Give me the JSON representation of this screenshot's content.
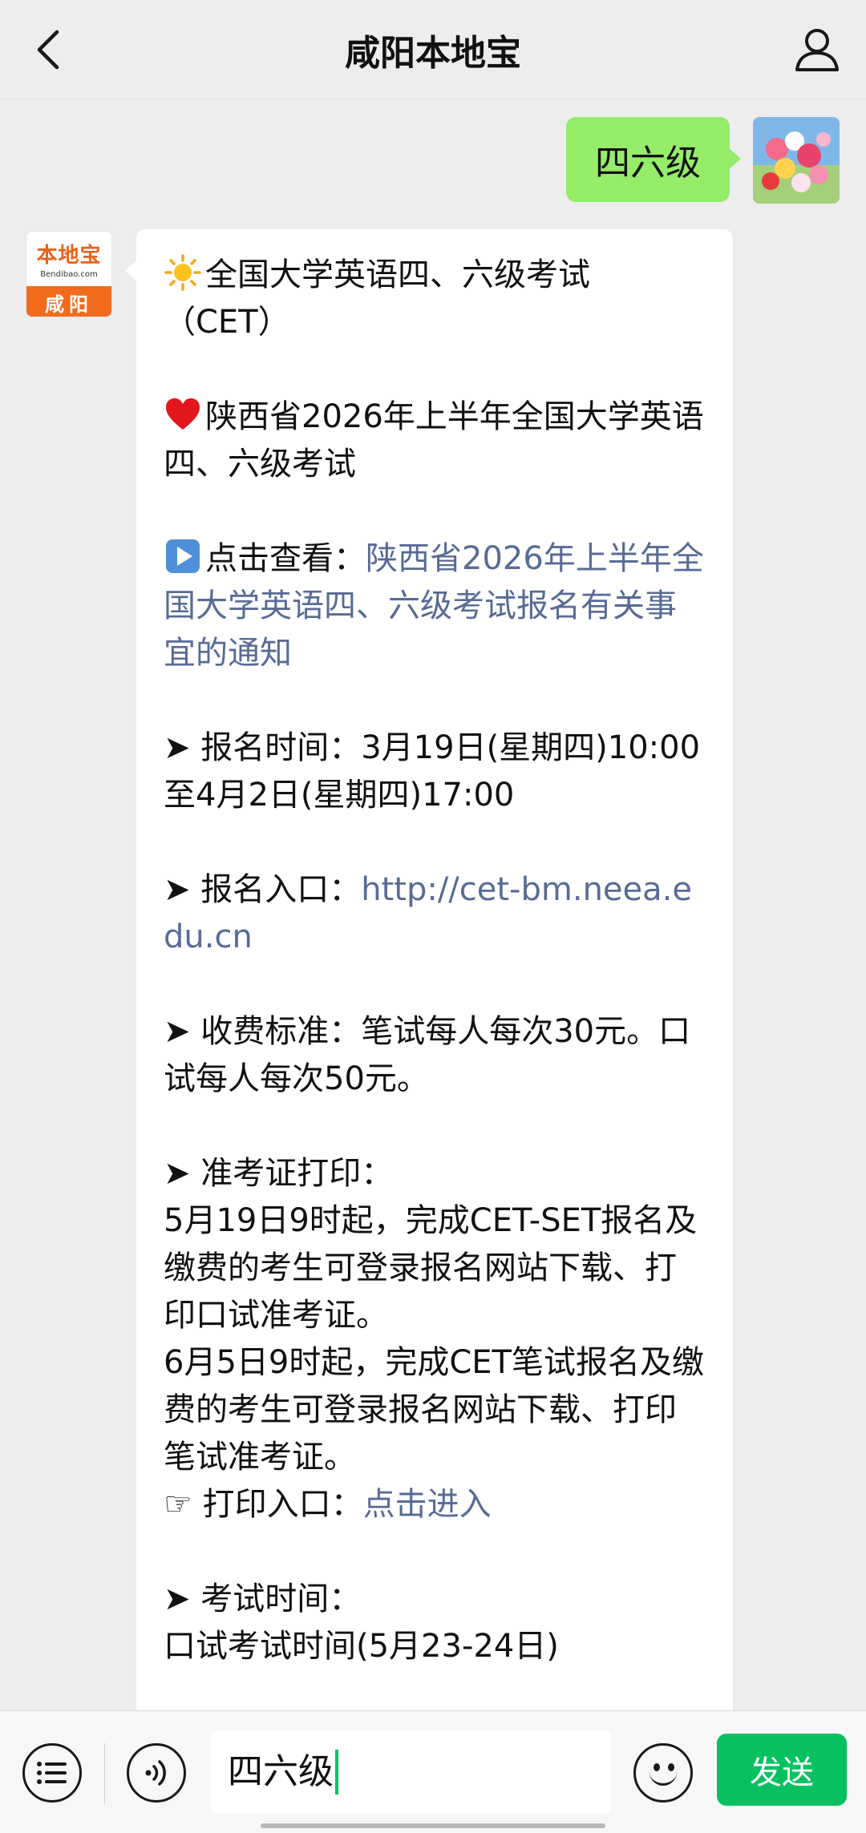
{
  "header": {
    "title": "咸阳本地宝"
  },
  "user_message": {
    "text": "四六级"
  },
  "bot_avatar": {
    "brand": "本地宝",
    "site": "Bendibao.com",
    "city": "咸阳"
  },
  "bot_message": {
    "title_line1": "全国大学英语四、六级考试",
    "title_line2": "（CET）",
    "heading": "陕西省2026年上半年全国大学英语四、六级考试",
    "notice_prefix": "点击查看：",
    "notice_link": "陕西省2026年上半年全国大学英语四、六级考试报名有关事宜的通知",
    "signup_time": "➤ 报名时间：3月19日(星期四)10:00至4月2日(星期四)17:00",
    "signup_entry_label": "➤ 报名入口：",
    "signup_entry_link": "http://cet-bm.neea.edu.cn",
    "fee": "➤ 收费标准：笔试每人每次30元。口试每人每次50元。",
    "admit_heading": "➤ 准考证打印：",
    "admit_oral": "5月19日9时起，完成CET-SET报名及缴费的考生可登录报名网站下载、打印口试准考证。",
    "admit_written": "6月5日9时起，完成CET笔试报名及缴费的考生可登录报名网站下载、打印笔试准考证。",
    "print_entry_label": "☞ 打印入口：",
    "print_entry_link": "点击进入",
    "exam_time_heading": "➤ 考试时间：",
    "exam_time_oral": "口试考试时间(5月23-24日)"
  },
  "input_bar": {
    "value": "四六级",
    "send_label": "发送"
  },
  "icons": {
    "back": "chevron-left-icon",
    "profile": "person-icon",
    "sun": "sun-emoji",
    "heart": "heart-emoji",
    "play": "play-button-emoji",
    "menu": "list-icon",
    "voice": "voice-icon",
    "emoji": "smiley-icon"
  },
  "colors": {
    "user_bubble": "#95ec69",
    "link": "#576b95",
    "send_button": "#07c160",
    "background": "#ededed"
  }
}
